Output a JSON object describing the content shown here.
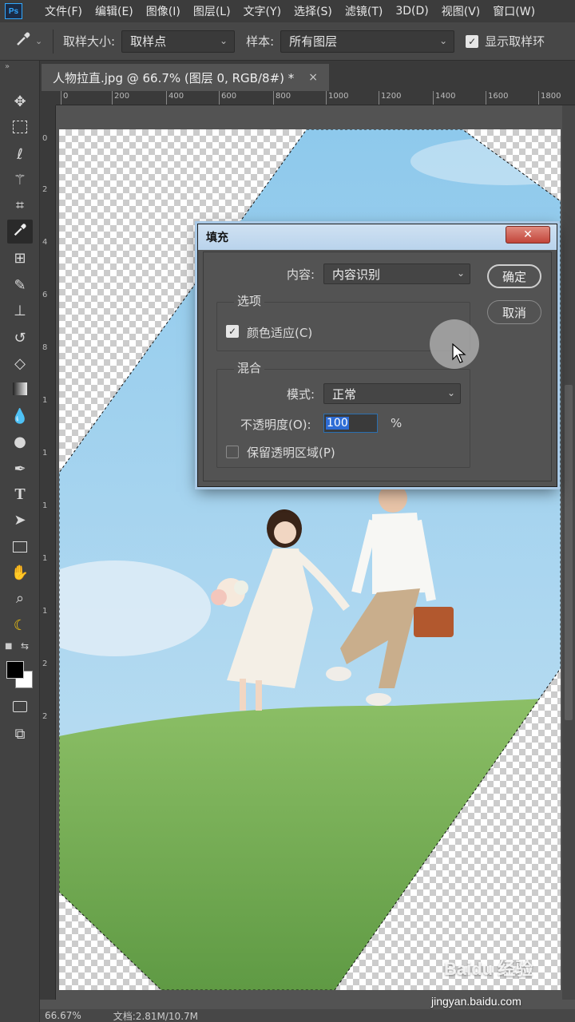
{
  "app": {
    "logo": "Ps"
  },
  "menu": [
    "文件(F)",
    "编辑(E)",
    "图像(I)",
    "图层(L)",
    "文字(Y)",
    "选择(S)",
    "滤镜(T)",
    "3D(D)",
    "视图(V)",
    "窗口(W)"
  ],
  "options": {
    "sample_size_label": "取样大小:",
    "sample_size_value": "取样点",
    "sample_label": "样本:",
    "sample_value": "所有图层",
    "show_ring_label": "显示取样环"
  },
  "document": {
    "tab_title": "人物拉直.jpg @ 66.7% (图层 0, RGB/8#) *",
    "close": "×"
  },
  "ruler": {
    "h_ticks": [
      "0",
      "200",
      "400",
      "600",
      "800",
      "1000",
      "1200",
      "1400",
      "1600",
      "1800"
    ],
    "v_ticks": [
      "0",
      "2",
      "4",
      "6",
      "8",
      "1",
      "1",
      "1",
      "1",
      "1",
      "2",
      "2"
    ]
  },
  "dialog": {
    "title": "填充",
    "close": "✕",
    "contents_label": "内容:",
    "contents_value": "内容识别",
    "ok": "确定",
    "cancel": "取消",
    "options_title": "选项",
    "color_adapt_label": "颜色适应(C)",
    "color_adapt_checked": true,
    "blend_title": "混合",
    "mode_label": "模式:",
    "mode_value": "正常",
    "opacity_label": "不透明度(O):",
    "opacity_value": "100",
    "opacity_unit": "%",
    "preserve_label": "保留透明区域(P)",
    "preserve_checked": false
  },
  "status": {
    "zoom": "66.67%",
    "doc": "文档:2.81M/10.7M"
  },
  "watermark": {
    "brand": "Baidu 经验",
    "url": "jingyan.baidu.com"
  },
  "colors": {
    "accent": "#31a8ff",
    "selection": "#2d6cd6",
    "sky": "#a8d4ee",
    "grass": "#7fb05a"
  }
}
